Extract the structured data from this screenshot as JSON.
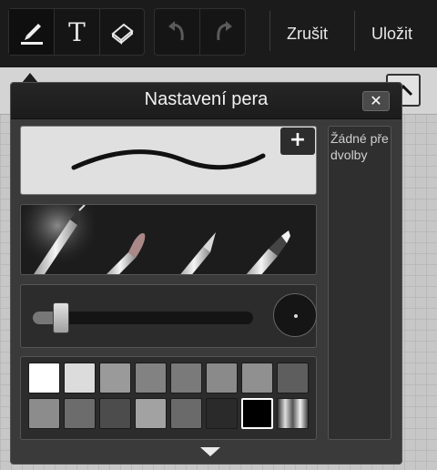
{
  "toolbar": {
    "cancel_label": "Zrušit",
    "save_label": "Uložit",
    "text_tool_glyph": "T",
    "tools": [
      "pen-icon",
      "text-icon",
      "eraser-icon"
    ],
    "history": [
      "undo-icon",
      "redo-icon"
    ]
  },
  "panel": {
    "title": "Nastavení pera",
    "close_glyph": "✕",
    "add_glyph": "+",
    "presets_empty": "Žádné předvolby",
    "pen_types": [
      "fine-pen-icon",
      "brush-icon",
      "pencil-icon",
      "marker-icon"
    ],
    "selected_pen": 0,
    "size_level": 0.13,
    "expand_icon": "chevron-down-icon"
  },
  "palette": {
    "colors": [
      "#ffffff",
      "#dcdcdc",
      "#9a9a9a",
      "#828282",
      "#7a7a7a",
      "#8a8a8a",
      "#909090",
      "#5e5e5e",
      "#8c8c8c",
      "#6c6c6c",
      "#4c4c4c",
      "#a2a2a2",
      "#6a6a6a",
      "#2a2a2a",
      "#000000",
      "gradient"
    ],
    "selected_index": 14
  },
  "colors": {
    "toolbar_bg": "#1b1b1b",
    "panel_bg": "#3a3a3a",
    "accent": "#ffffff"
  }
}
